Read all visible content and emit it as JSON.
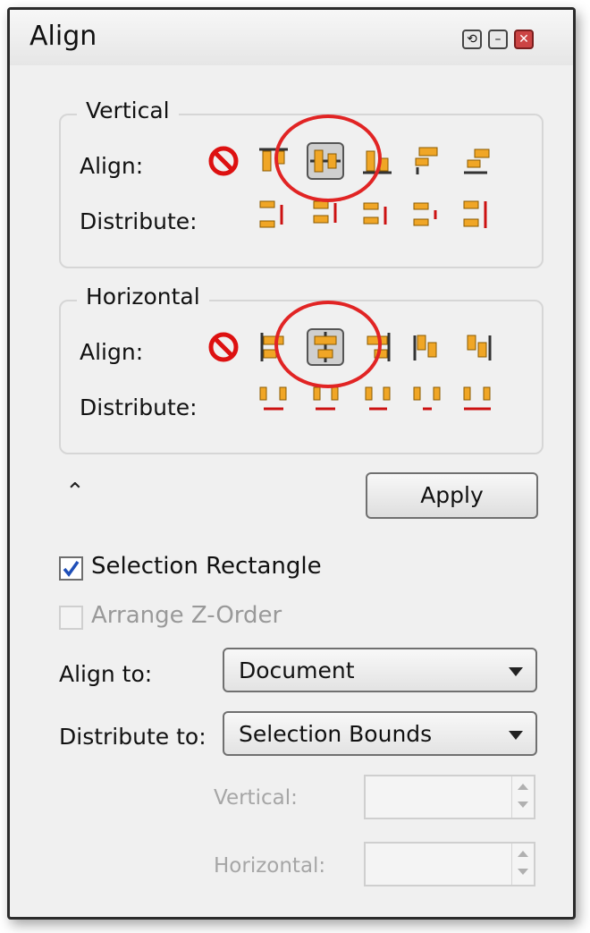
{
  "window": {
    "title": "Align",
    "buttons": [
      "float-toggle",
      "minimize",
      "close"
    ]
  },
  "vertical": {
    "legend": "Vertical",
    "align_label": "Align:",
    "distribute_label": "Distribute:",
    "align_icons": [
      "none-icon",
      "align-top-icon",
      "align-middle-icon",
      "align-bottom-icon",
      "stack-top-icon",
      "stack-bottom-icon"
    ],
    "selected_align_icon": "align-middle-icon",
    "distribute_icons": [
      "distribute-top-icon",
      "distribute-center-icon",
      "distribute-bottom-icon",
      "distribute-gap-icon",
      "distribute-space-icon"
    ]
  },
  "horizontal": {
    "legend": "Horizontal",
    "align_label": "Align:",
    "distribute_label": "Distribute:",
    "align_icons": [
      "none-icon",
      "align-left-icon",
      "align-center-icon",
      "align-right-icon",
      "stack-left-icon",
      "stack-right-icon"
    ],
    "selected_align_icon": "align-center-icon",
    "distribute_icons": [
      "distribute-left-icon",
      "distribute-center-icon",
      "distribute-right-icon",
      "distribute-gap-icon",
      "distribute-space-icon"
    ]
  },
  "annotation_color": "#e12424",
  "apply_label": "Apply",
  "selection_rectangle": {
    "label": "Selection Rectangle",
    "checked": true
  },
  "arrange_z_order": {
    "label": "Arrange Z-Order",
    "checked": false,
    "disabled": true
  },
  "align_to": {
    "label": "Align to:",
    "value": "Document"
  },
  "distribute_to": {
    "label": "Distribute to:",
    "value": "Selection Bounds"
  },
  "vertical_spin": {
    "label": "Vertical:",
    "value": ""
  },
  "horizontal_spin": {
    "label": "Horizontal:",
    "value": ""
  }
}
